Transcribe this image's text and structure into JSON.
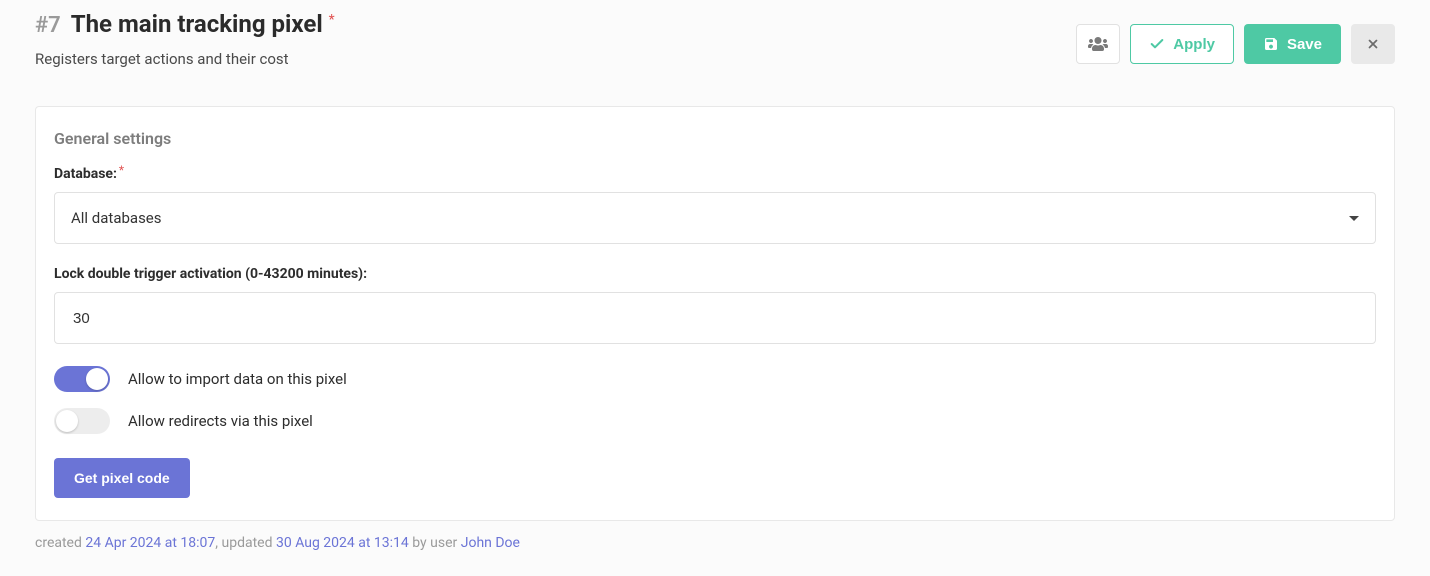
{
  "header": {
    "id_prefix": "#7",
    "title": "The  main tracking pixel",
    "subtitle": "Registers target actions and their cost"
  },
  "actions": {
    "apply_label": "Apply",
    "save_label": "Save"
  },
  "panel": {
    "title": "General settings",
    "database_label": "Database:",
    "database_value": "All databases",
    "lock_label": "Lock double trigger activation (0-43200 minutes):",
    "lock_value": "30",
    "toggle_import_label": "Allow to import data on this pixel",
    "toggle_redirect_label": "Allow redirects via this pixel",
    "get_code_label": "Get pixel code"
  },
  "footer": {
    "created_label": "created",
    "created_at": "24 Apr 2024 at 18:07",
    "updated_label": ", updated",
    "updated_at": "30 Aug 2024 at 13:14",
    "by_user_label": "by user",
    "user_name": "John Doe"
  }
}
